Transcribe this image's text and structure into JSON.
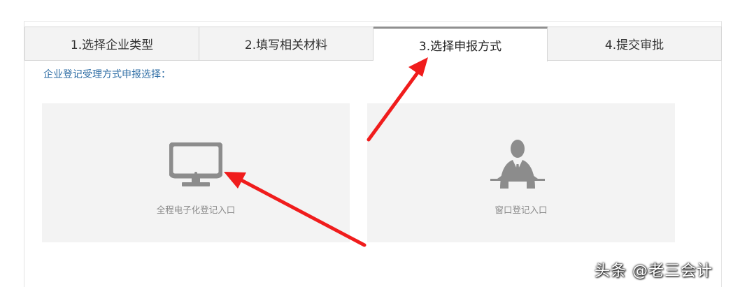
{
  "tabs": [
    {
      "label": "1.选择企业类型",
      "active": false
    },
    {
      "label": "2.填写相关材料",
      "active": false
    },
    {
      "label": "3.选择申报方式",
      "active": true
    },
    {
      "label": "4.提交审批",
      "active": false
    }
  ],
  "prompt": "企业登记受理方式申报选择：",
  "options": {
    "online": {
      "label": "全程电子化登记入口",
      "icon": "monitor-icon"
    },
    "window": {
      "label": "窗口登记入口",
      "icon": "person-icon"
    }
  },
  "colors": {
    "arrow": "#f01c1c",
    "prompt": "#2f6ea5",
    "icon": "#8c8c8c",
    "card_bg": "#f3f3f3"
  },
  "watermark": "头条 @老三会计"
}
